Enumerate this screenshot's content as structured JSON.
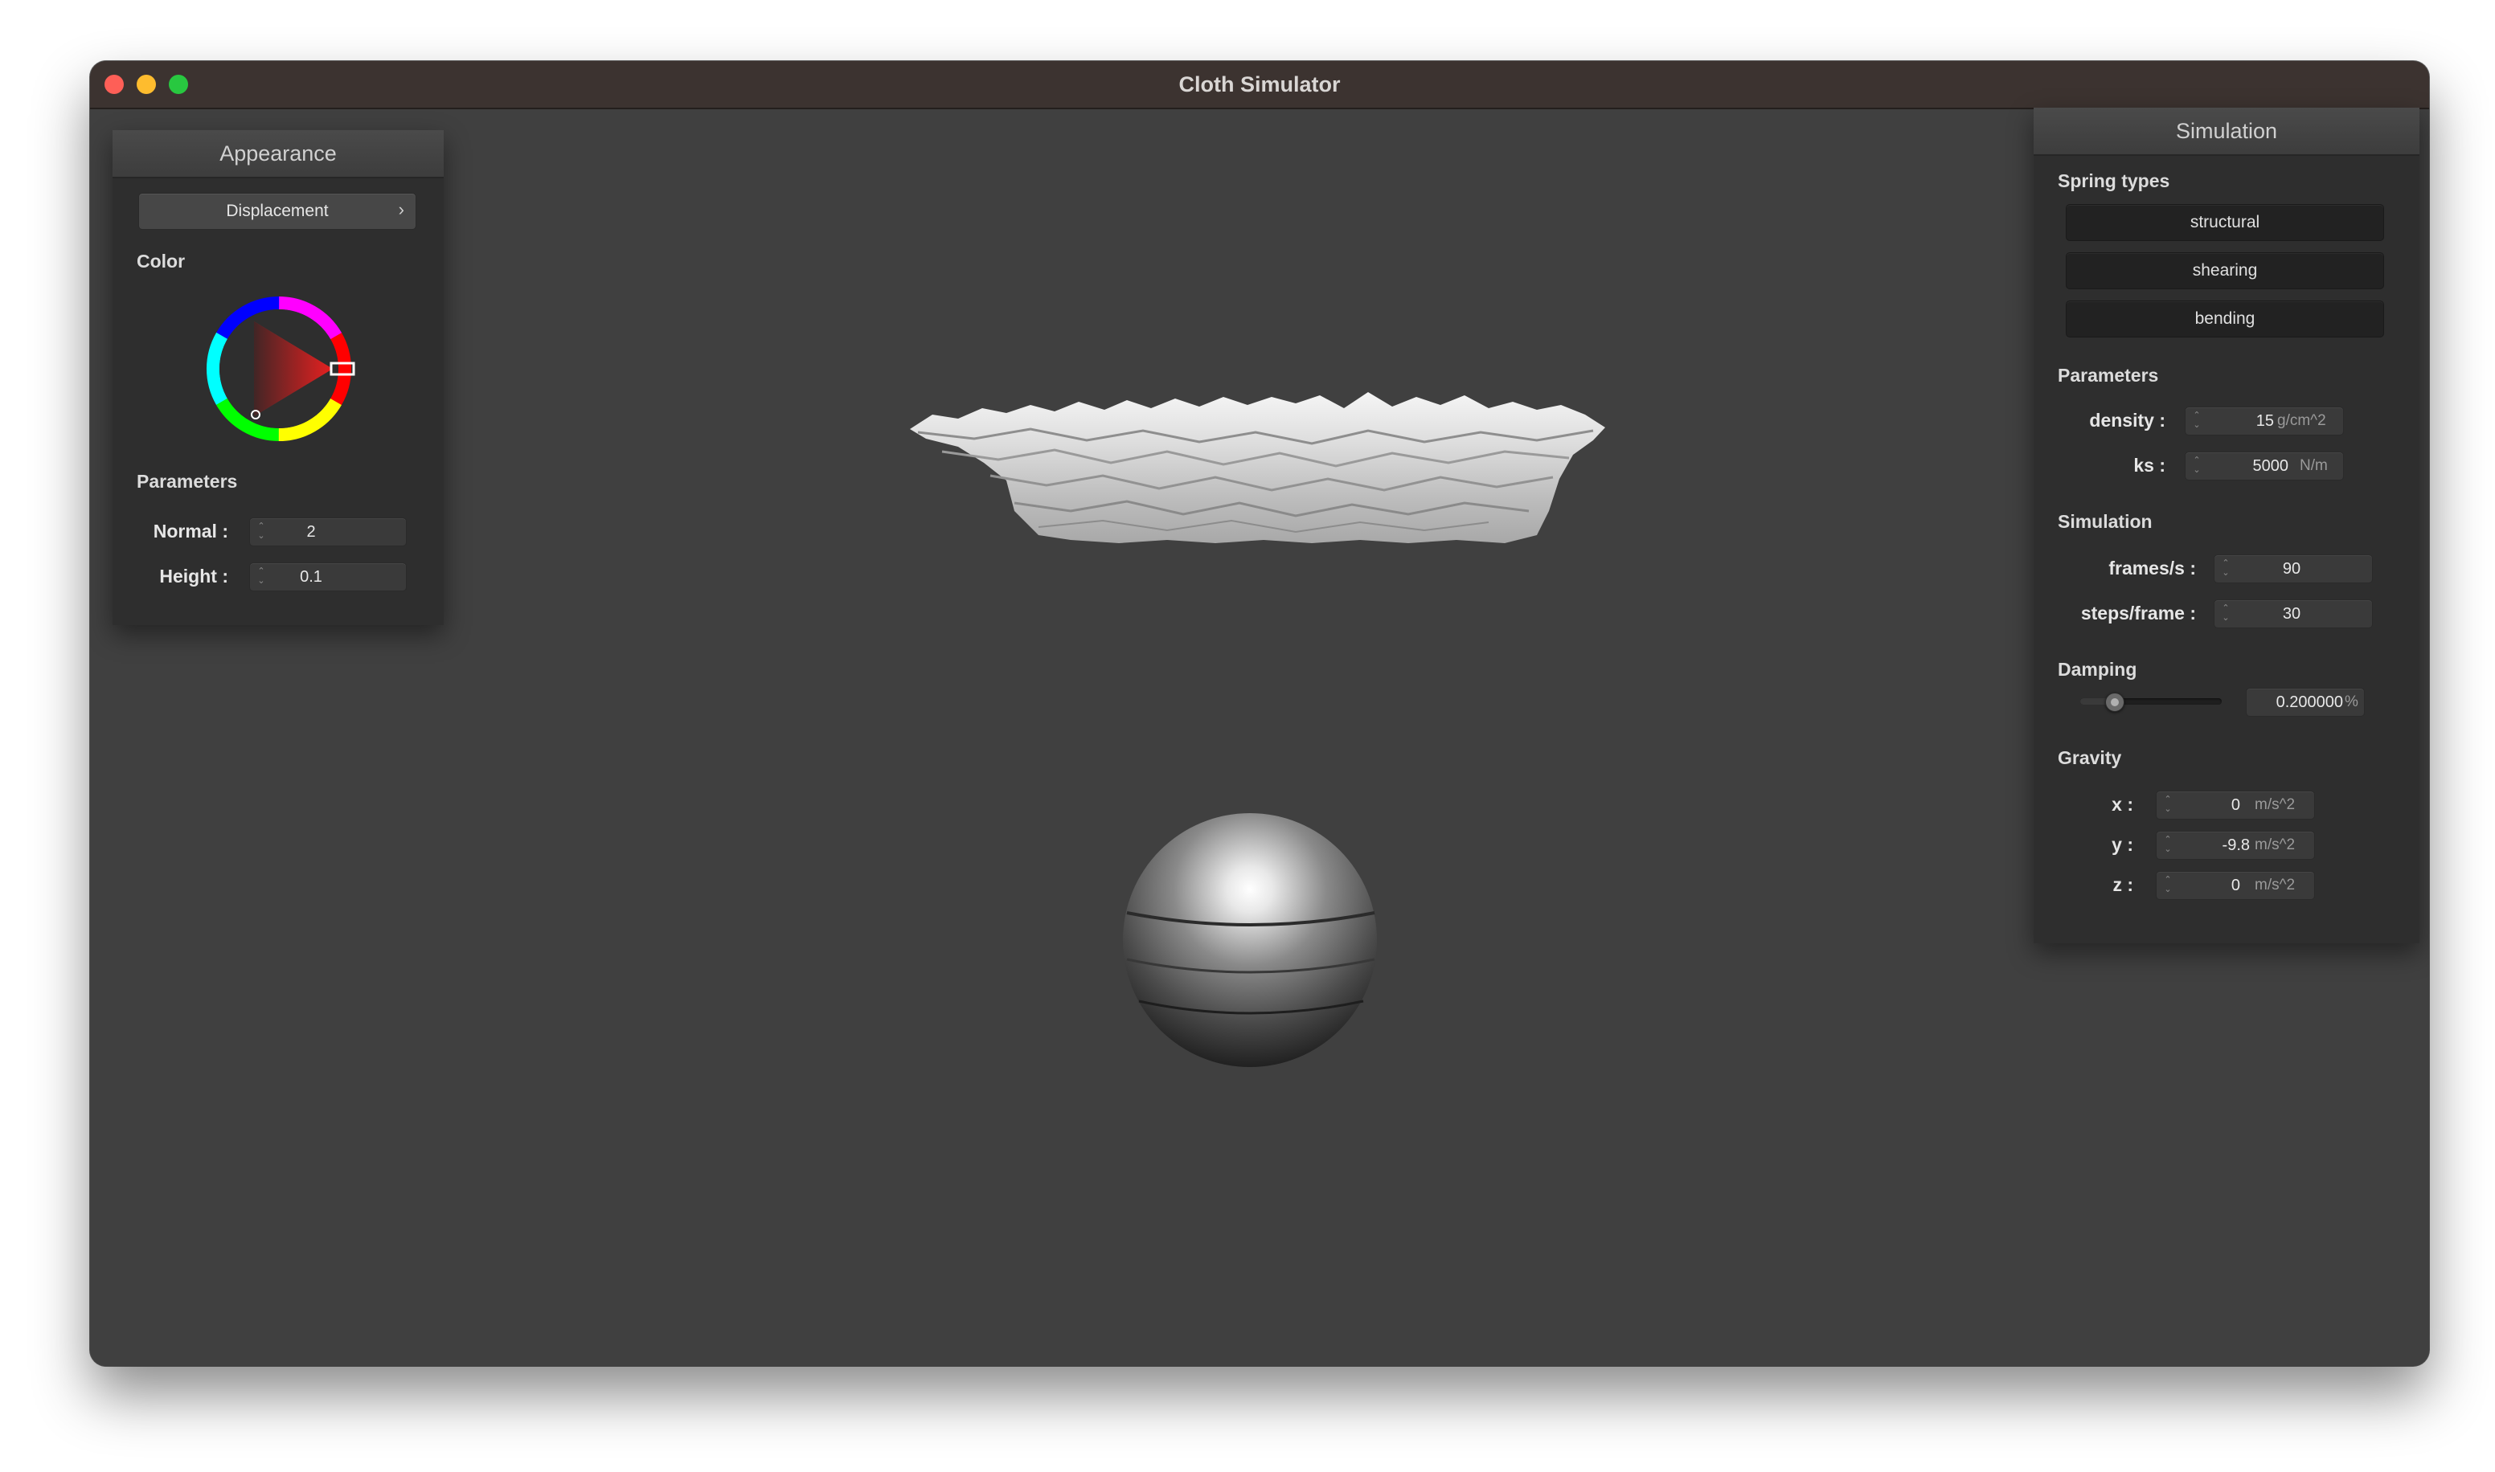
{
  "window": {
    "title": "Cloth Simulator"
  },
  "appearance": {
    "title": "Appearance",
    "shader_dropdown": {
      "value": "Displacement",
      "chevron": "›"
    },
    "color_label": "Color",
    "color_wheel_icon": "color-wheel-icon",
    "parameters_label": "Parameters",
    "normal": {
      "label": "Normal :",
      "value": "2"
    },
    "height": {
      "label": "Height :",
      "value": "0.1"
    }
  },
  "simulation": {
    "title": "Simulation",
    "spring_types_label": "Spring types",
    "spring_buttons": [
      "structural",
      "shearing",
      "bending"
    ],
    "parameters_label": "Parameters",
    "density": {
      "label": "density :",
      "value": "15",
      "unit": "g/cm^2"
    },
    "ks": {
      "label": "ks :",
      "value": "5000",
      "unit": "N/m"
    },
    "simulation_label": "Simulation",
    "frames": {
      "label": "frames/s :",
      "value": "90"
    },
    "steps": {
      "label": "steps/frame :",
      "value": "30"
    },
    "damping_label": "Damping",
    "damping": {
      "value": "0.200000",
      "unit": "%",
      "slider_level": 0.2
    },
    "gravity_label": "Gravity",
    "gravity": [
      {
        "label": "x :",
        "value": "0",
        "unit": "m/s^2"
      },
      {
        "label": "y :",
        "value": "-9.8",
        "unit": "m/s^2"
      },
      {
        "label": "z :",
        "value": "0",
        "unit": "m/s^2"
      }
    ]
  },
  "colors": {
    "viewport": "#404040",
    "titlebar": "#3c3330",
    "panel": "#2e2e2e",
    "close": "#fe5f57",
    "minimize": "#febc2e",
    "maximize": "#28c840"
  }
}
